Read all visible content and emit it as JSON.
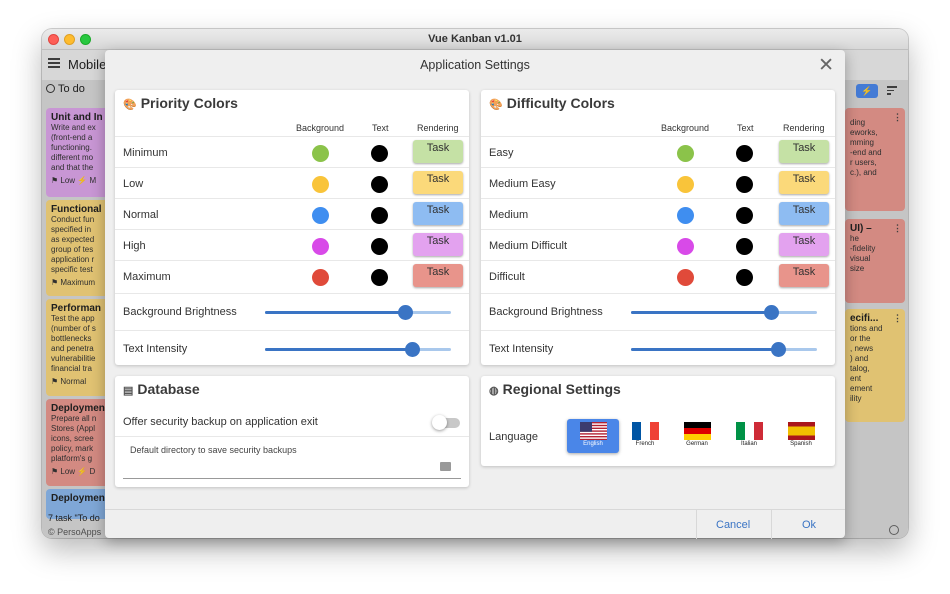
{
  "window": {
    "title": "Vue Kanban v1.01"
  },
  "board": {
    "title": "Mobile",
    "column": "To do",
    "footer_count": "7 task \"To do",
    "footer_copyright": "© PersoApps",
    "cards": [
      {
        "title": "Unit and In",
        "body": [
          "Write and ex",
          "(front-end a",
          "functioning.",
          "different mo",
          "and that the"
        ],
        "footer": "⚑ Low  ⚡ M",
        "color": "#d9a3e6"
      },
      {
        "title": "Functional",
        "body": [
          "Conduct fun",
          "specified in",
          "as expected",
          "group of tes",
          "application r",
          "specific test"
        ],
        "footer": "⚑ Maximum",
        "color": "#f3d37c"
      },
      {
        "title": "Performan",
        "body": [
          "Test the app",
          "(number of s",
          "bottlenecks",
          "and penetra",
          "vulnerabilitie",
          "financial tra"
        ],
        "footer": "⚑ Normal",
        "color": "#f3d37c"
      },
      {
        "title": "Deploymen",
        "body": [
          "Prepare all n",
          "Stores (Appl",
          "icons, scree",
          "policy, mark",
          "platform's g"
        ],
        "footer": "⚑ Low  ⚡ D",
        "color": "#e5968e"
      },
      {
        "title": "Deploymen",
        "body": [],
        "footer": "",
        "color": "#8ab6ea"
      }
    ],
    "right_cards": [
      {
        "title": "",
        "body": [
          "ding",
          "eworks,",
          "mming",
          "-end and",
          "r users,",
          "c.), and"
        ],
        "color": "#e5968e"
      },
      {
        "title": "UI) –",
        "body": [
          "he",
          "-fidelity",
          "visual",
          "size"
        ],
        "color": "#e5968e"
      },
      {
        "title": "ecifi...",
        "body": [
          "tions and",
          "or the",
          ", news",
          ") and",
          "talog,",
          "ent",
          "ement",
          "ility"
        ],
        "color": "#f3d37c"
      }
    ]
  },
  "dialog": {
    "title": "Application Settings",
    "priority": {
      "title": "Priority Colors",
      "headers": {
        "background": "Background",
        "text": "Text",
        "rendering": "Rendering"
      },
      "rows": [
        {
          "label": "Minimum",
          "bg": "#8bc34a",
          "text_color": "#000000",
          "chip": "Task",
          "chip_bg": "#c5e1a5"
        },
        {
          "label": "Low",
          "bg": "#f9c43a",
          "text_color": "#000000",
          "chip": "Task",
          "chip_bg": "#fbd97a"
        },
        {
          "label": "Normal",
          "bg": "#3f8ef0",
          "text_color": "#000000",
          "chip": "Task",
          "chip_bg": "#8ebcf2"
        },
        {
          "label": "High",
          "bg": "#d84ae8",
          "text_color": "#000000",
          "chip": "Task",
          "chip_bg": "#e3a2ef"
        },
        {
          "label": "Maximum",
          "bg": "#e04a3a",
          "text_color": "#000000",
          "chip": "Task",
          "chip_bg": "#e8948b"
        }
      ],
      "brightness_label": "Background Brightness",
      "brightness": 0.75,
      "intensity_label": "Text Intensity",
      "intensity": 0.79
    },
    "difficulty": {
      "title": "Difficulty Colors",
      "headers": {
        "background": "Background",
        "text": "Text",
        "rendering": "Rendering"
      },
      "rows": [
        {
          "label": "Easy",
          "bg": "#8bc34a",
          "text_color": "#000000",
          "chip": "Task",
          "chip_bg": "#c5e1a5"
        },
        {
          "label": "Medium Easy",
          "bg": "#f9c43a",
          "text_color": "#000000",
          "chip": "Task",
          "chip_bg": "#fbd97a"
        },
        {
          "label": "Medium",
          "bg": "#3f8ef0",
          "text_color": "#000000",
          "chip": "Task",
          "chip_bg": "#8ebcf2"
        },
        {
          "label": "Medium Difficult",
          "bg": "#d84ae8",
          "text_color": "#000000",
          "chip": "Task",
          "chip_bg": "#e3a2ef"
        },
        {
          "label": "Difficult",
          "bg": "#e04a3a",
          "text_color": "#000000",
          "chip": "Task",
          "chip_bg": "#e8948b"
        }
      ],
      "brightness_label": "Background Brightness",
      "brightness": 0.75,
      "intensity_label": "Text Intensity",
      "intensity": 0.79
    },
    "database": {
      "title": "Database",
      "backup_label": "Offer security backup on application exit",
      "backup_enabled": false,
      "dir_label": "Default directory to save security backups",
      "dir_value": ""
    },
    "regional": {
      "title": "Regional Settings",
      "language_label": "Language",
      "languages": [
        {
          "name": "English",
          "selected": true
        },
        {
          "name": "French",
          "selected": false
        },
        {
          "name": "German",
          "selected": false
        },
        {
          "name": "Italian",
          "selected": false
        },
        {
          "name": "Spanish",
          "selected": false
        }
      ]
    },
    "cancel": "Cancel",
    "ok": "Ok"
  }
}
